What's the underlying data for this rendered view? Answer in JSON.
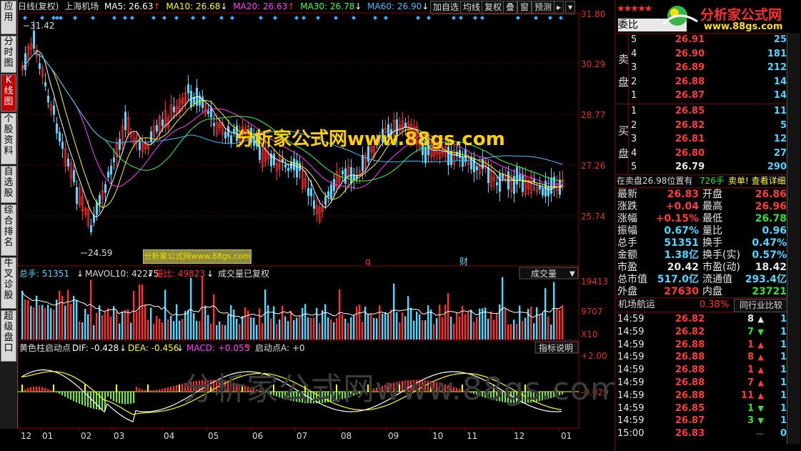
{
  "sidebar": {
    "tabs": [
      "应用",
      "分时图",
      "K线图",
      "个股资料",
      "自选股",
      "综合排名",
      "牛叉诊股",
      "超级盘口"
    ],
    "active": "K线图"
  },
  "header": {
    "period": "日线(复权)",
    "stock": "上海机场",
    "ma5": "MA5: 26.63",
    "ma10": "MA10: 26.68",
    "ma20": "MA20: 26.63",
    "ma30": "MA30: 26.78",
    "ma60": "MA60: 26.90",
    "buttons": [
      "加自选",
      "均线",
      "复权",
      "叠",
      "窗",
      "预测"
    ],
    "ma_colors": {
      "ma5": "#ffffff",
      "ma10": "#ffff00",
      "ma20": "#ff40ff",
      "ma30": "#40ff40",
      "ma60": "#40c0ff"
    }
  },
  "price_panel": {
    "high_mark": "31.42",
    "low_mark": "24.59",
    "y_ticks": [
      "31.80",
      "30.29",
      "28.77",
      "27.26",
      "25.74"
    ],
    "markers": [
      "q",
      "财"
    ]
  },
  "volume_panel": {
    "total_label": "总手: 51351",
    "mavol_label": "MAVOL10: 42275",
    "ratio_label": "量比: 49823",
    "note": "成交量已复权",
    "dropdown": "成交量",
    "y_ticks": [
      "19413",
      "9707",
      "X10"
    ]
  },
  "macd_panel": {
    "title": "黄色柱启动点",
    "dif": "DIF: -0.428",
    "dea": "DEA: -0.456",
    "macd": "MACD: +0.055",
    "start": "启动点A: +0",
    "help_button": "指标说明",
    "y_ticks": [
      "+2.00",
      "-0.029"
    ]
  },
  "x_axis": [
    "12",
    "01",
    "02",
    "03",
    "04",
    "05",
    "06",
    "07",
    "08",
    "09",
    "10",
    "11",
    "12",
    "01"
  ],
  "watermarks": {
    "center": "分析家公式网www.88gs.com",
    "small": "分析家公式网www.88gs.com",
    "bottom": "分析家公式网www.88gs.com"
  },
  "logo": {
    "title": "分析家公式网",
    "url": "www.88gs.com"
  },
  "right_panel": {
    "wei_bi_label": "委比",
    "sell_label": [
      "卖",
      "盘"
    ],
    "buy_label": [
      "买",
      "盘"
    ],
    "sell": [
      {
        "lvl": "5",
        "price": "26.91",
        "vol": "25"
      },
      {
        "lvl": "4",
        "price": "26.90",
        "vol": "181"
      },
      {
        "lvl": "3",
        "price": "26.89",
        "vol": "212"
      },
      {
        "lvl": "2",
        "price": "26.88",
        "vol": "14"
      },
      {
        "lvl": "1",
        "price": "26.87",
        "vol": "14"
      }
    ],
    "buy": [
      {
        "lvl": "1",
        "price": "26.85",
        "vol": "11"
      },
      {
        "lvl": "2",
        "price": "26.82",
        "vol": "5"
      },
      {
        "lvl": "3",
        "price": "26.81",
        "vol": "12"
      },
      {
        "lvl": "4",
        "price": "26.80",
        "vol": "27"
      },
      {
        "lvl": "5",
        "price": "26.79",
        "vol": "290"
      }
    ],
    "notice_left": "在卖盘26.98位置有",
    "notice_vol": "726手",
    "notice_right": "卖单! 查看详细",
    "quote": [
      {
        "l1": "最新",
        "v1": "26.83",
        "c1": "red",
        "l2": "开盘",
        "v2": "26.86",
        "c2": "red"
      },
      {
        "l1": "涨跌",
        "v1": "+0.04",
        "c1": "red",
        "l2": "最高",
        "v2": "26.96",
        "c2": "red"
      },
      {
        "l1": "涨幅",
        "v1": "+0.15%",
        "c1": "red",
        "l2": "最低",
        "v2": "26.78",
        "c2": "green"
      },
      {
        "l1": "振幅",
        "v1": "0.67%",
        "c1": "cyan",
        "l2": "量比",
        "v2": "0.96",
        "c2": "cyan"
      },
      {
        "l1": "总手",
        "v1": "51351",
        "c1": "cyan",
        "l2": "换手",
        "v2": "0.47%",
        "c2": "cyan"
      },
      {
        "l1": "金额",
        "v1": "1.38亿",
        "c1": "cyan",
        "l2": "换手(实)",
        "v2": "0.57%",
        "c2": "cyan"
      },
      {
        "l1": "市盈",
        "v1": "20.42",
        "c1": "white",
        "l2": "市盈(动)",
        "v2": "18.42",
        "c2": "white"
      },
      {
        "l1": "总市值",
        "v1": "517.0亿",
        "c1": "cyan",
        "l2": "流通值",
        "v2": "293.4亿",
        "c2": "cyan"
      },
      {
        "l1": "外盘",
        "v1": "27630",
        "c1": "red",
        "l2": "内盘",
        "v2": "23721",
        "c2": "green"
      }
    ],
    "industry_name": "机场航运",
    "industry_pct": "0.38%",
    "industry_button": "同行业比较",
    "ticks": [
      {
        "t": "14:59",
        "p": "26.82",
        "v": "8",
        "dir": "up-white",
        "n": "1"
      },
      {
        "t": "14:59",
        "p": "26.82",
        "v": "7",
        "dir": "down",
        "n": "1"
      },
      {
        "t": "14:59",
        "p": "26.88",
        "v": "1",
        "dir": "up",
        "n": "1"
      },
      {
        "t": "14:59",
        "p": "26.88",
        "v": "8",
        "dir": "up",
        "n": "1"
      },
      {
        "t": "14:59",
        "p": "26.88",
        "v": "1",
        "dir": "up",
        "n": "1"
      },
      {
        "t": "14:59",
        "p": "26.88",
        "v": "7",
        "dir": "up",
        "n": "1"
      },
      {
        "t": "14:59",
        "p": "26.88",
        "v": "11",
        "dir": "up",
        "n": "1"
      },
      {
        "t": "14:59",
        "p": "26.85",
        "v": "1",
        "dir": "down",
        "n": "1"
      },
      {
        "t": "14:59",
        "p": "26.87",
        "v": "3",
        "dir": "down",
        "n": "1"
      },
      {
        "t": "15:00",
        "p": "26.83",
        "v": "",
        "dir": "dash",
        "n": "0"
      }
    ]
  }
}
